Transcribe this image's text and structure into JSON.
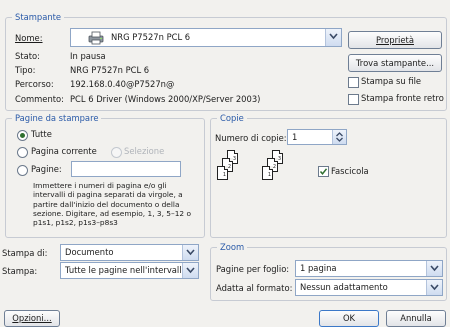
{
  "printer": {
    "title": "Stampante",
    "name_label": "Nome:",
    "name_value": "NRG P7527n PCL 6",
    "status_label": "Stato:",
    "status_value": "In pausa",
    "type_label": "Tipo:",
    "type_value": "NRG P7527n PCL 6",
    "path_label": "Percorso:",
    "path_value": "192.168.0.40@P7527n@",
    "comment_label": "Commento:",
    "comment_value": "PCL 6 Driver (Windows 2000/XP/Server 2003)",
    "properties_button": "Proprietà",
    "find_button": "Trova stampante...",
    "print_to_file": "Stampa su file",
    "duplex": "Stampa fronte retro"
  },
  "pages": {
    "title": "Pagine da stampare",
    "all": "Tutte",
    "current": "Pagina corrente",
    "selection": "Selezione",
    "pages_label": "Pagine:",
    "pages_value": "",
    "help_text": "Immettere i numeri di pagina e/o gli intervalli di pagina separati da virgole, a partire dall'inizio del documento o della sezione. Digitare, ad esempio, 1, 3, 5–12 o p1s1, p1s2, p1s3–p8s3"
  },
  "copies": {
    "title": "Copie",
    "count_label": "Numero di copie:",
    "count_value": "1",
    "collate": "Fascicola",
    "stack1": [
      "3",
      "2",
      "1"
    ],
    "stack2": [
      "3",
      "2",
      "1"
    ]
  },
  "print_what": {
    "label": "Stampa di:",
    "value": "Documento"
  },
  "print_range": {
    "label": "Stampa:",
    "value": "Tutte le pagine nell'intervallo"
  },
  "zoom": {
    "title": "Zoom",
    "per_sheet_label": "Pagine per foglio:",
    "per_sheet_value": "1 pagina",
    "scale_label": "Adatta al formato:",
    "scale_value": "Nessun adattamento"
  },
  "footer": {
    "options": "Opzioni...",
    "ok": "OK",
    "cancel": "Annulla"
  }
}
